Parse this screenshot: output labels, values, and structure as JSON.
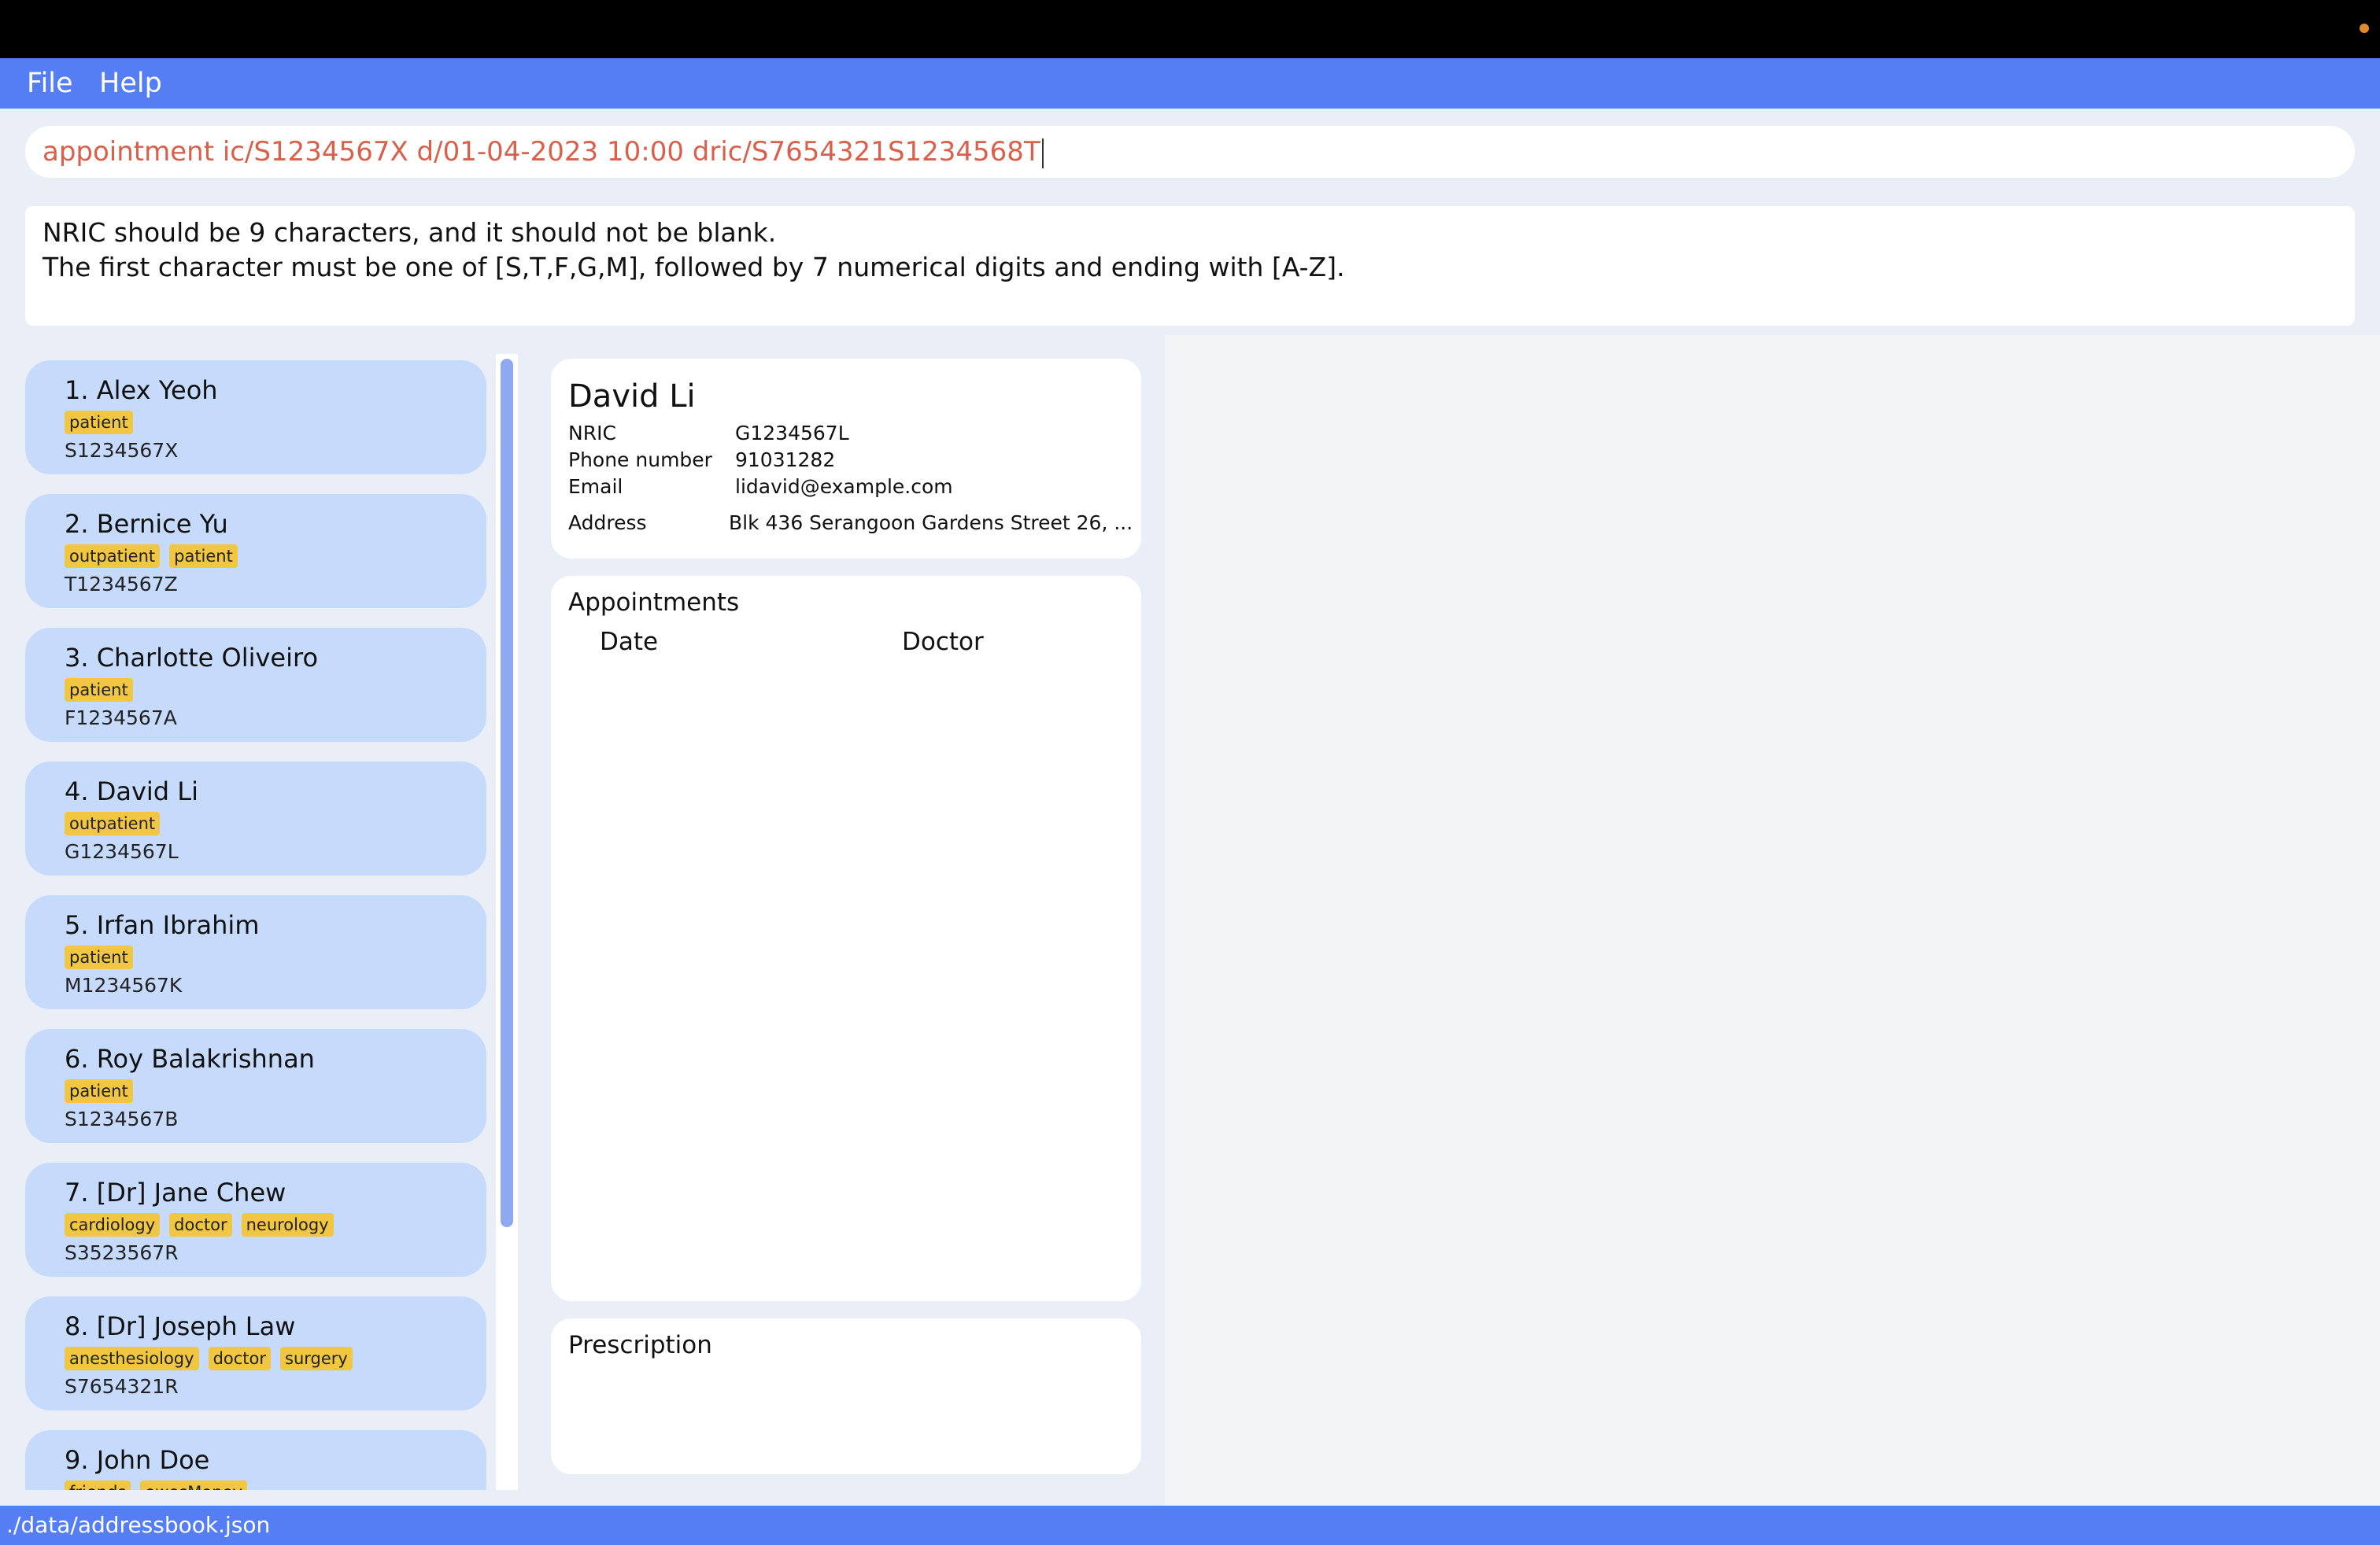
{
  "menu": {
    "file_label": "File",
    "help_label": "Help"
  },
  "command": {
    "value": "appointment ic/S1234567X d/01-04-2023 10:00 dric/S7654321S1234568T"
  },
  "result": {
    "line1": "NRIC should be 9 characters, and it should not be blank.",
    "line2": "The first character must be one of [S,T,F,G,M], followed by 7 numerical digits and ending with [A-Z]."
  },
  "persons": [
    {
      "name": "1.  Alex Yeoh",
      "tags": [
        "patient"
      ],
      "nric": "S1234567X"
    },
    {
      "name": "2.  Bernice Yu",
      "tags": [
        "outpatient",
        "patient"
      ],
      "nric": "T1234567Z"
    },
    {
      "name": "3.  Charlotte Oliveiro",
      "tags": [
        "patient"
      ],
      "nric": "F1234567A"
    },
    {
      "name": "4.  David Li",
      "tags": [
        "outpatient"
      ],
      "nric": "G1234567L"
    },
    {
      "name": "5.  Irfan Ibrahim",
      "tags": [
        "patient"
      ],
      "nric": "M1234567K"
    },
    {
      "name": "6.  Roy Balakrishnan",
      "tags": [
        "patient"
      ],
      "nric": "S1234567B"
    },
    {
      "name": "7.  [Dr] Jane Chew",
      "tags": [
        "cardiology",
        "doctor",
        "neurology"
      ],
      "nric": "S3523567R"
    },
    {
      "name": "8.  [Dr] Joseph Law",
      "tags": [
        "anesthesiology",
        "doctor",
        "surgery"
      ],
      "nric": "S7654321R"
    },
    {
      "name": "9.  John Doe",
      "tags": [
        "friends",
        "owesMoney"
      ],
      "nric": ""
    }
  ],
  "detail": {
    "name": "David Li",
    "nric_label": "NRIC",
    "nric_value": "G1234567L",
    "phone_label": "Phone number",
    "phone_value": "91031282",
    "email_label": "Email",
    "email_value": "lidavid@example.com",
    "address_label": "Address",
    "address_value": "Blk 436 Serangoon Gardens Street 26, ..."
  },
  "appointments": {
    "title": "Appointments",
    "col_date": "Date",
    "col_doctor": "Doctor"
  },
  "prescription": {
    "title": "Prescription"
  },
  "status": {
    "path": "./data/addressbook.json"
  },
  "colors": {
    "accent": "#557ef5",
    "card_bg": "#c6dbfc",
    "tag_bg": "#f0c642",
    "error_text": "#d9604a"
  }
}
